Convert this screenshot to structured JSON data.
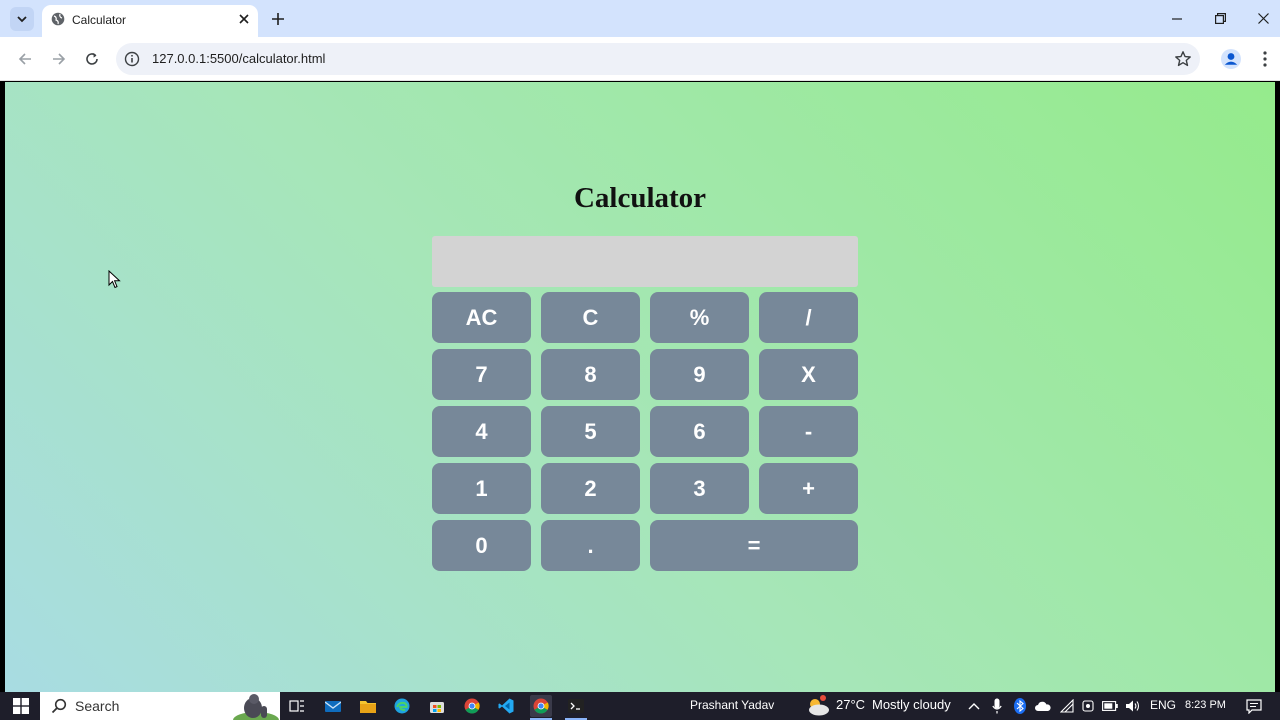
{
  "browser": {
    "tab_title": "Calculator",
    "url": "127.0.0.1:5500/calculator.html"
  },
  "page": {
    "title": "Calculator",
    "display_value": "",
    "keys": [
      "AC",
      "C",
      "%",
      "/",
      "7",
      "8",
      "9",
      "X",
      "4",
      "5",
      "6",
      "-",
      "1",
      "2",
      "3",
      "+",
      "0",
      ".",
      "="
    ]
  },
  "taskbar": {
    "search_label": "Search",
    "user_name": "Prashant Yadav",
    "weather_temp": "27°C",
    "weather_text": "Mostly cloudy",
    "language": "ENG",
    "time": "8:23 PM"
  },
  "colors": {
    "key_bg": "#778899",
    "display_bg": "#d3d3d3",
    "bg_gradient_start": "#a8dce2",
    "bg_gradient_end": "#95eb8c"
  }
}
